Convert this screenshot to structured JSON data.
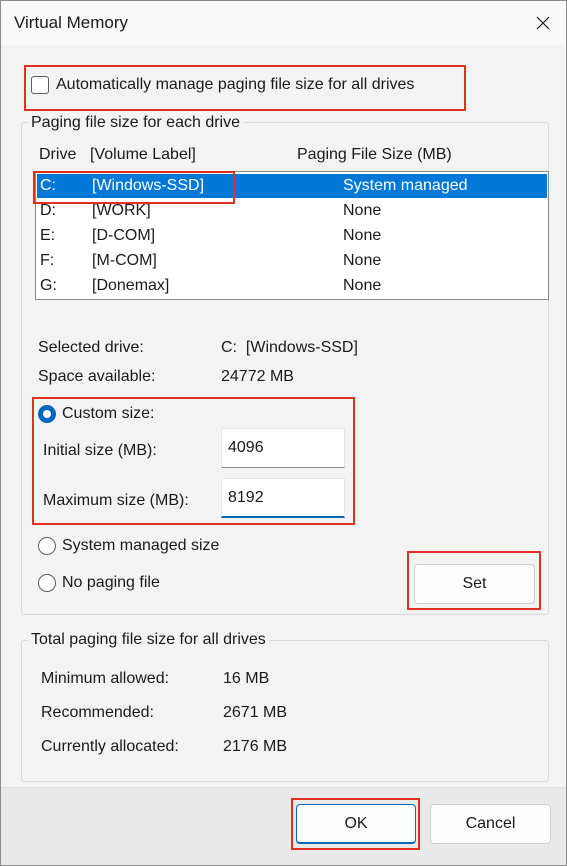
{
  "window": {
    "title": "Virtual Memory"
  },
  "auto_manage": {
    "label": "Automatically manage paging file size for all drives",
    "checked": false
  },
  "paging_group": {
    "caption": "Paging file size for each drive",
    "headers": {
      "drive": "Drive",
      "volume": "[Volume Label]",
      "size": "Paging File Size (MB)"
    },
    "rows": [
      {
        "drive": "C:",
        "label": "[Windows-SSD]",
        "size": "System managed",
        "selected": true
      },
      {
        "drive": "D:",
        "label": "[WORK]",
        "size": "None",
        "selected": false
      },
      {
        "drive": "E:",
        "label": "[D-COM]",
        "size": "None",
        "selected": false
      },
      {
        "drive": "F:",
        "label": "[M-COM]",
        "size": "None",
        "selected": false
      },
      {
        "drive": "G:",
        "label": "[Donemax]",
        "size": "None",
        "selected": false
      }
    ],
    "selected_drive_label": "Selected drive:",
    "selected_drive_value": "C:  [Windows-SSD]",
    "space_available_label": "Space available:",
    "space_available_value": "24772 MB",
    "custom_size_label": "Custom size:",
    "initial_size_label": "Initial size (MB):",
    "initial_size_value": "4096",
    "maximum_size_label": "Maximum size (MB):",
    "maximum_size_value": "8192",
    "system_managed_label": "System managed size",
    "no_paging_label": "No paging file",
    "set_button": "Set"
  },
  "total_group": {
    "caption": "Total paging file size for all drives",
    "minimum_label": "Minimum allowed:",
    "minimum_value": "16 MB",
    "recommended_label": "Recommended:",
    "recommended_value": "2671 MB",
    "allocated_label": "Currently allocated:",
    "allocated_value": "2176 MB"
  },
  "footer": {
    "ok_button": "OK",
    "cancel_button": "Cancel"
  },
  "colors": {
    "accent": "#0067c0",
    "selection": "#0078d7",
    "highlight": "#e0301e"
  },
  "icons": {
    "close": "close-icon"
  }
}
